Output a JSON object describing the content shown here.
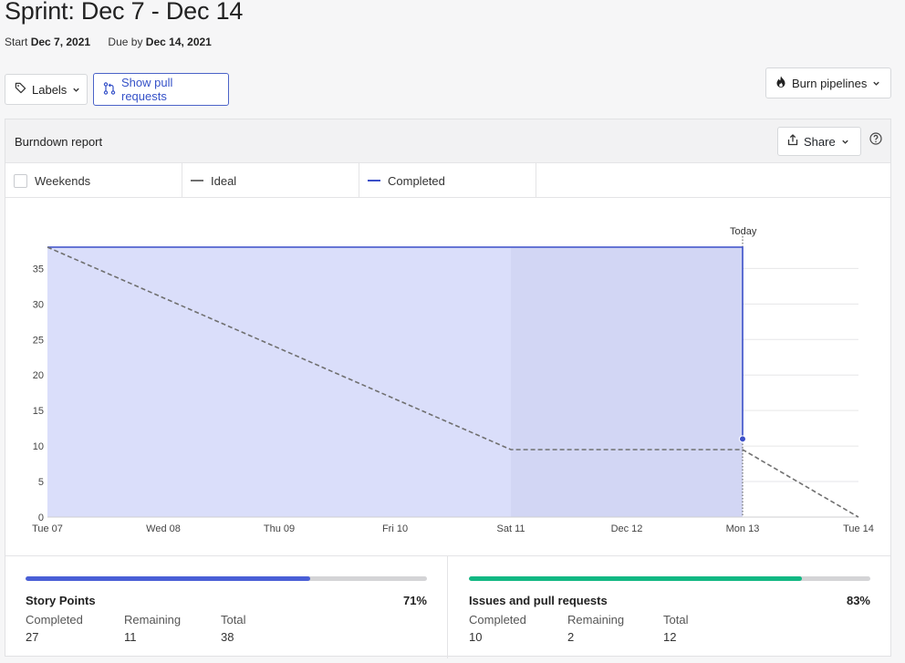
{
  "header": {
    "title": "Sprint: Dec 7 - Dec 14",
    "start_label": "Start",
    "start_date": "Dec 7, 2021",
    "due_label": "Due by",
    "due_date": "Dec 14, 2021"
  },
  "toolbar": {
    "labels_button": "Labels",
    "show_prs_button": "Show pull requests",
    "burn_pipelines_button": "Burn pipelines"
  },
  "report": {
    "title": "Burndown report",
    "share_button": "Share"
  },
  "legend": {
    "weekends": "Weekends",
    "ideal": "Ideal",
    "completed": "Completed"
  },
  "colors": {
    "completed_line": "#3b4fc8",
    "completed_fill": "#dadefa",
    "weekend_fill": "#d2d6f4",
    "ideal_line": "#707070",
    "story_points_bar": "#4a5fd6",
    "issues_bar": "#12b883"
  },
  "chart_data": {
    "type": "area",
    "x": [
      "Tue 07",
      "Wed 08",
      "Thu 09",
      "Fri 10",
      "Sat 11",
      "Dec 12",
      "Mon 13",
      "Tue 14"
    ],
    "ylim": [
      0,
      38
    ],
    "yticks": [
      0,
      5,
      10,
      15,
      20,
      25,
      30,
      35
    ],
    "today_index": 6,
    "today_label": "Today",
    "weekend_range": [
      "Sat 11",
      "Mon 13"
    ],
    "grid": true,
    "series": [
      {
        "name": "Completed",
        "style": "solid",
        "points": [
          {
            "x": "Tue 07",
            "y": 38
          },
          {
            "x": "Mon 13",
            "y": 38
          },
          {
            "x": "Mon 13",
            "y": 11
          }
        ]
      },
      {
        "name": "Ideal",
        "style": "dashed",
        "points": [
          {
            "x": "Tue 07",
            "y": 38
          },
          {
            "x": "Sat 11",
            "y": 9.5
          },
          {
            "x": "Mon 13",
            "y": 9.5
          },
          {
            "x": "Tue 14",
            "y": 0
          }
        ]
      }
    ]
  },
  "stats": {
    "story_points": {
      "title": "Story Points",
      "percent": "71%",
      "progress": 0.71,
      "completed_label": "Completed",
      "remaining_label": "Remaining",
      "total_label": "Total",
      "completed": "27",
      "remaining": "11",
      "total": "38"
    },
    "issues": {
      "title": "Issues and pull requests",
      "percent": "83%",
      "progress": 0.83,
      "completed_label": "Completed",
      "remaining_label": "Remaining",
      "total_label": "Total",
      "completed": "10",
      "remaining": "2",
      "total": "12"
    }
  }
}
